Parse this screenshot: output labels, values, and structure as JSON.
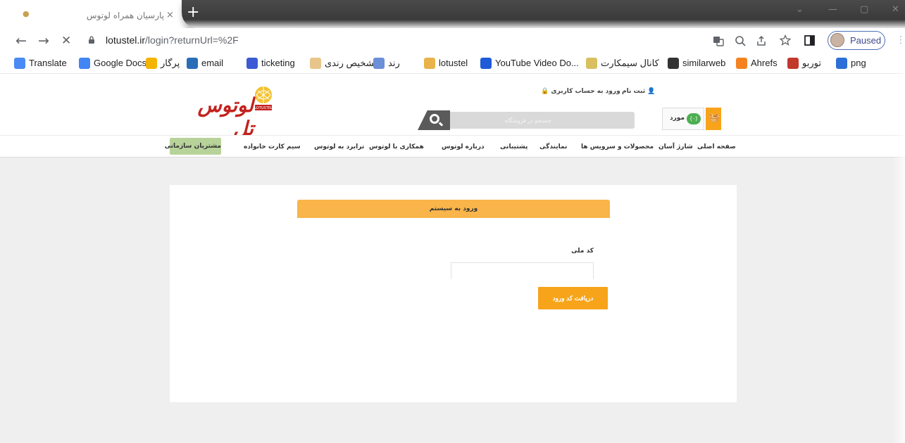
{
  "browser": {
    "tab": {
      "title": "پارسیان همراه لوتوس",
      "close": "×"
    },
    "new_tab": "+",
    "window_controls": [
      "⌄",
      "—",
      "▢",
      "✕"
    ],
    "url_host": "lotustel.ir",
    "url_path": "/login?returnUrl=%2F",
    "nav": {
      "back": "←",
      "forward": "→",
      "stop": "✕"
    },
    "profile_label": "Paused",
    "bookmarks": [
      {
        "label": "Translate",
        "icon": "translate-icon",
        "color": "#4a8af4"
      },
      {
        "label": "Google Docs",
        "icon": "docs-icon",
        "color": "#4285f4"
      },
      {
        "label": "پرگار",
        "icon": "pargar-icon",
        "color": "#f4b400"
      },
      {
        "label": "email",
        "icon": "email-icon",
        "color": "#2a6eb8"
      },
      {
        "label": "ticketing",
        "icon": "ticketing-icon",
        "color": "#3b5bd4"
      },
      {
        "label": "تشخیص رندی",
        "icon": "rendi-icon",
        "color": "#e8c58a"
      },
      {
        "label": "رند",
        "icon": "rand-icon",
        "color": "#6b8fd8"
      },
      {
        "label": "lotustel",
        "icon": "lotustel-icon",
        "color": "#e8b34a"
      },
      {
        "label": "YouTube Video Do...",
        "icon": "youtube-downloader-icon",
        "color": "#1f5bd8"
      },
      {
        "label": "کانال سیمکارت",
        "icon": "telegram-icon",
        "color": "#d8c060"
      },
      {
        "label": "similarweb",
        "icon": "similarweb-icon",
        "color": "#333333"
      },
      {
        "label": "Ahrefs",
        "icon": "ahrefs-icon",
        "color": "#f58220"
      },
      {
        "label": "توربو",
        "icon": "turbo-icon",
        "color": "#c0392b"
      },
      {
        "label": "png",
        "icon": "png-icon",
        "color": "#2d6fd8"
      }
    ]
  },
  "site": {
    "logo_text": "لوتوس تل",
    "logo_badge": "LOTUSTEL",
    "search_placeholder": "جستجو در فروشگاه",
    "register": "ثبت نام",
    "login_link": "ورود به حساب کاربری",
    "cart_count": "(۰)",
    "cart_label": "مورد",
    "nav": [
      "صفحه اصلی",
      "شارژ آسان",
      "محصولات و سرویس ها",
      "نمایندگی",
      "پشتیبانی",
      "درباره لوتوس",
      "همکاری با لوتوس",
      "ترابرد به لوتوس",
      "سیم کارت خانواده"
    ],
    "nav_org": "مشتریان سازمانی",
    "login": {
      "title": "ورود به سیستم",
      "field_label": "کد ملی",
      "button": "دریافت کد ورود"
    }
  }
}
